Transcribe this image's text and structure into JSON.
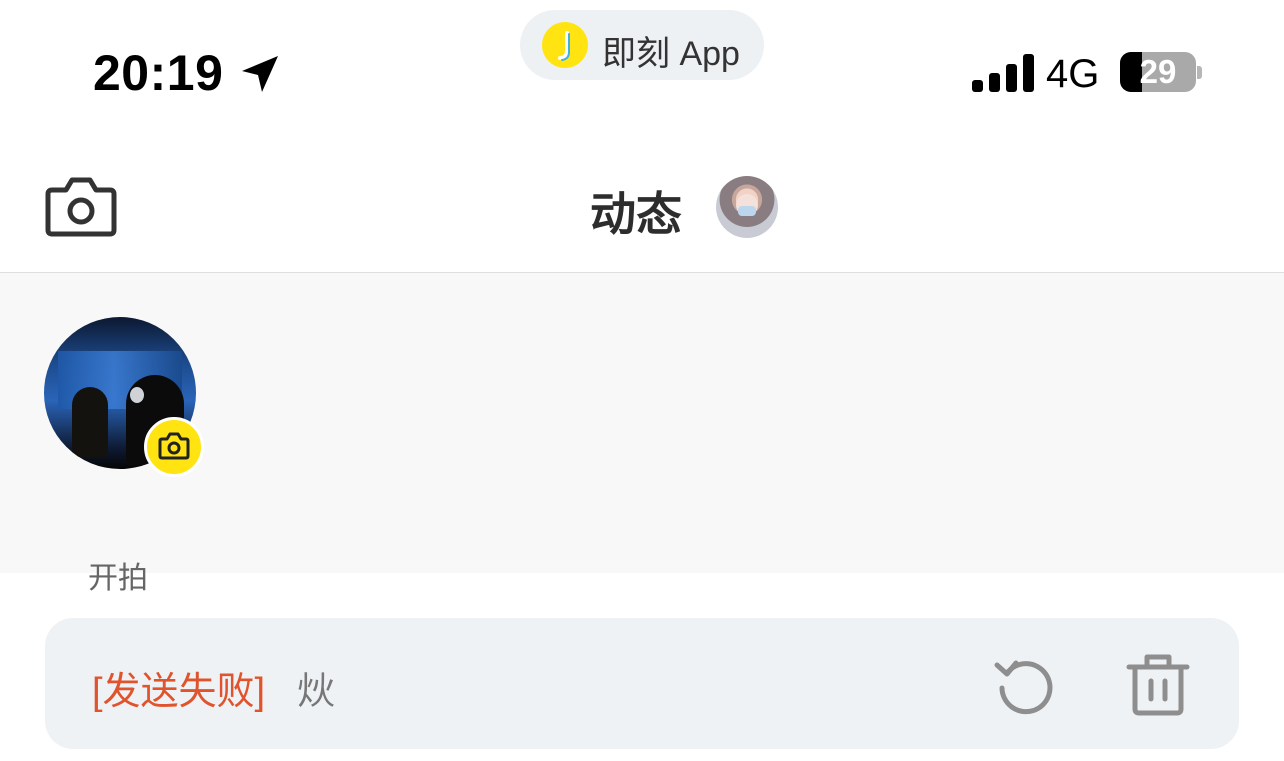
{
  "status_bar": {
    "time": "20:19",
    "app_pill_label": "即刻 App",
    "app_pill_logo_letter": "J",
    "network": "4G",
    "battery_level": "29",
    "battery_percent": 29
  },
  "nav": {
    "title": "动态"
  },
  "stories": {
    "items": [
      {
        "label": "开拍"
      }
    ]
  },
  "failed_post": {
    "status": "[发送失败]",
    "text": "炏"
  },
  "colors": {
    "brand_yellow": "#ffe411",
    "error_red": "#e0542d",
    "card_bg": "#eff2f5"
  }
}
